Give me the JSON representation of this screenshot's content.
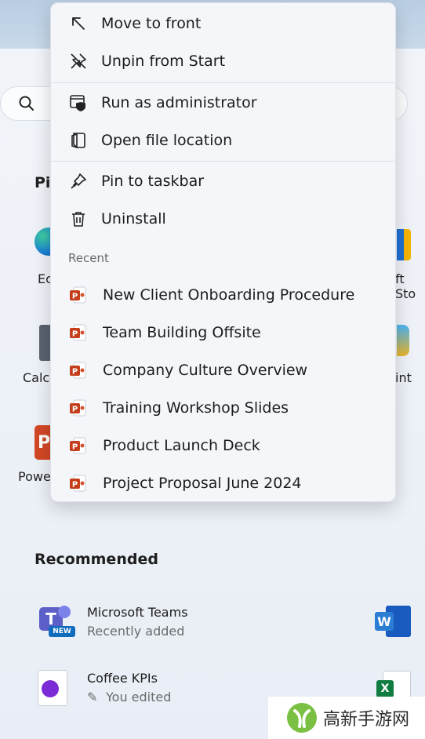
{
  "context_menu": {
    "items": [
      {
        "label": "Move to front",
        "icon": "move-to-front-icon"
      },
      {
        "label": "Unpin from Start",
        "icon": "unpin-icon"
      },
      {
        "label": "Run as administrator",
        "icon": "shield-icon"
      },
      {
        "label": "Open file location",
        "icon": "folder-icon"
      },
      {
        "label": "Pin to taskbar",
        "icon": "pin-icon"
      },
      {
        "label": "Uninstall",
        "icon": "trash-icon"
      }
    ],
    "recent_header": "Recent",
    "recent_files": [
      "New Client Onboarding Procedure",
      "Team Building Offsite",
      "Company Culture Overview",
      "Training Workshop Slides",
      "Product Launch Deck",
      "Project Proposal June 2024"
    ]
  },
  "start": {
    "pinned_partial": "Pi",
    "apps_left": [
      "Ec",
      "Calcu",
      "Powe"
    ],
    "apps_right": [
      "ft Sto",
      "int"
    ],
    "recommended_title": "Recommended",
    "recommended": [
      {
        "name": "Microsoft Teams",
        "sub": "Recently added"
      },
      {
        "name": "Coffee KPIs",
        "sub": "You edited"
      }
    ]
  },
  "watermark": {
    "text": "高新手游网"
  },
  "colors": {
    "accent": "#c43e1c",
    "menu_bg": "#f4f6f9"
  }
}
